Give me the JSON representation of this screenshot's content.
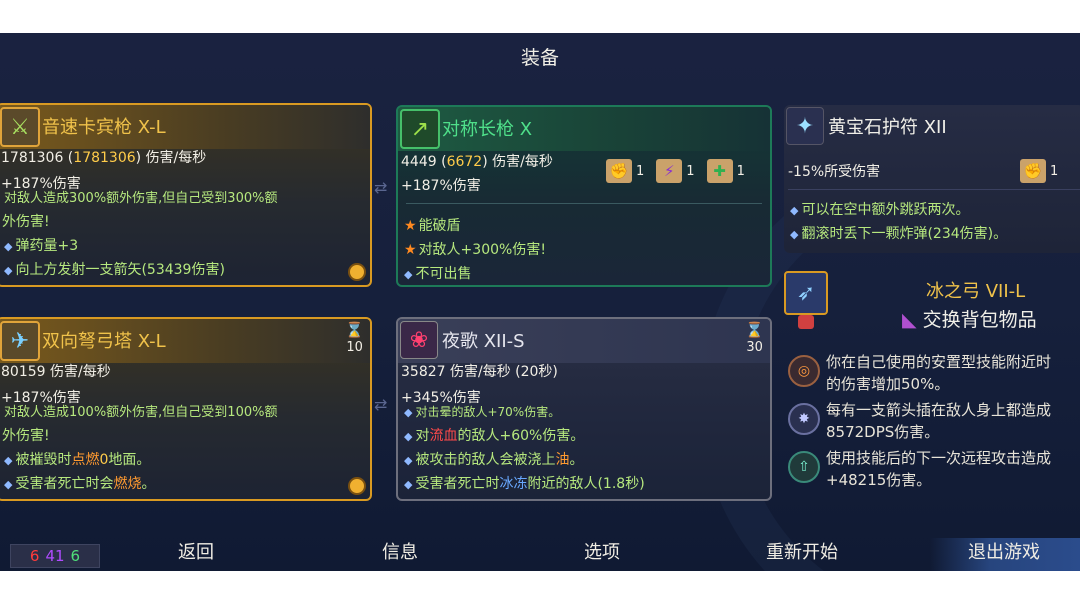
{
  "screen_title": "装备",
  "weapons": [
    {
      "name": "音速卡宾枪 X-L",
      "dps_base": "1781306",
      "dps_bonus": "1781306",
      "dps_suffix": "伤害/每秒",
      "bonus": "+187%伤害",
      "cut_line": "对敌人造成300%额外伤害,但自己受到300%额",
      "cut_line_cont": "外伤害!",
      "mods": [
        "弹药量+3",
        "向上方发射一支箭矢(53439伤害)"
      ]
    },
    {
      "name": "对称长枪 X",
      "dps_base": "4449",
      "dps_bonus": "6672",
      "dps_suffix": "伤害/每秒",
      "bonus": "+187%伤害",
      "scrolls": [
        "1",
        "1",
        "1"
      ],
      "mods": [
        "能破盾",
        "对敌人+300%伤害!",
        "不可出售"
      ]
    }
  ],
  "skills": [
    {
      "name": "双向弩弓塔 X-L",
      "timer": "10",
      "stat": "80159 伤害/每秒",
      "bonus": "+187%伤害",
      "cut_line": "对敌人造成100%额外伤害,但自己受到100%额",
      "cut_line_cont": "外伤害!",
      "mods": [
        {
          "pre": "被摧毁时",
          "hl": "点燃",
          "hl2": "0",
          "post": "地面。"
        },
        {
          "pre": "受害者死亡时会",
          "hl": "燃烧",
          "post": "。"
        }
      ]
    },
    {
      "name": "夜歌 XII-S",
      "timer": "30",
      "stat": "35827 伤害/每秒 (20秒)",
      "bonus": "+345%伤害",
      "cut_line": "对击晕的敌人+70%伤害。",
      "mods": [
        {
          "pre": "对",
          "hl": "流血",
          "post": "的敌人+60%伤害。"
        },
        {
          "pre": "被攻击的敌人会被浇上",
          "hl": "油",
          "post": "。"
        },
        {
          "pre": "受害者死亡时",
          "hl": "冰冻",
          "post": "附近的敌人(1.8秒)"
        }
      ]
    }
  ],
  "amulet": {
    "name": "黄宝石护符 XII",
    "stat": "-15%所受伤害",
    "scroll_count": "1",
    "mods": [
      "可以在空中额外跳跃两次。",
      "翻滚时丢下一颗炸弹(234伤害)。"
    ]
  },
  "backpack": {
    "name": "冰之弓 VII-L",
    "action": "交换背包物品",
    "mutations": [
      {
        "line1": "你在自己使用的安置型技能附近时",
        "line2": "的伤害增加50%。"
      },
      {
        "line1": "每有一支箭头插在敌人身上都造成",
        "line2": "8572DPS伤害。"
      },
      {
        "line1": "使用技能后的下一次远程攻击造成",
        "line2": "+48215伤害。"
      }
    ]
  },
  "stats": {
    "brutality": "6",
    "tactics": "41",
    "survival": "6"
  },
  "menu": {
    "back": "返回",
    "info": "信息",
    "options": "选项",
    "restart": "重新开始",
    "quit": "退出游戏"
  },
  "colors": {
    "brutality": "#ff3b3b",
    "tactics": "#b04bff",
    "survival": "#4fe07a",
    "gold_border": "#d99a22",
    "green_border": "#1d7a58"
  }
}
